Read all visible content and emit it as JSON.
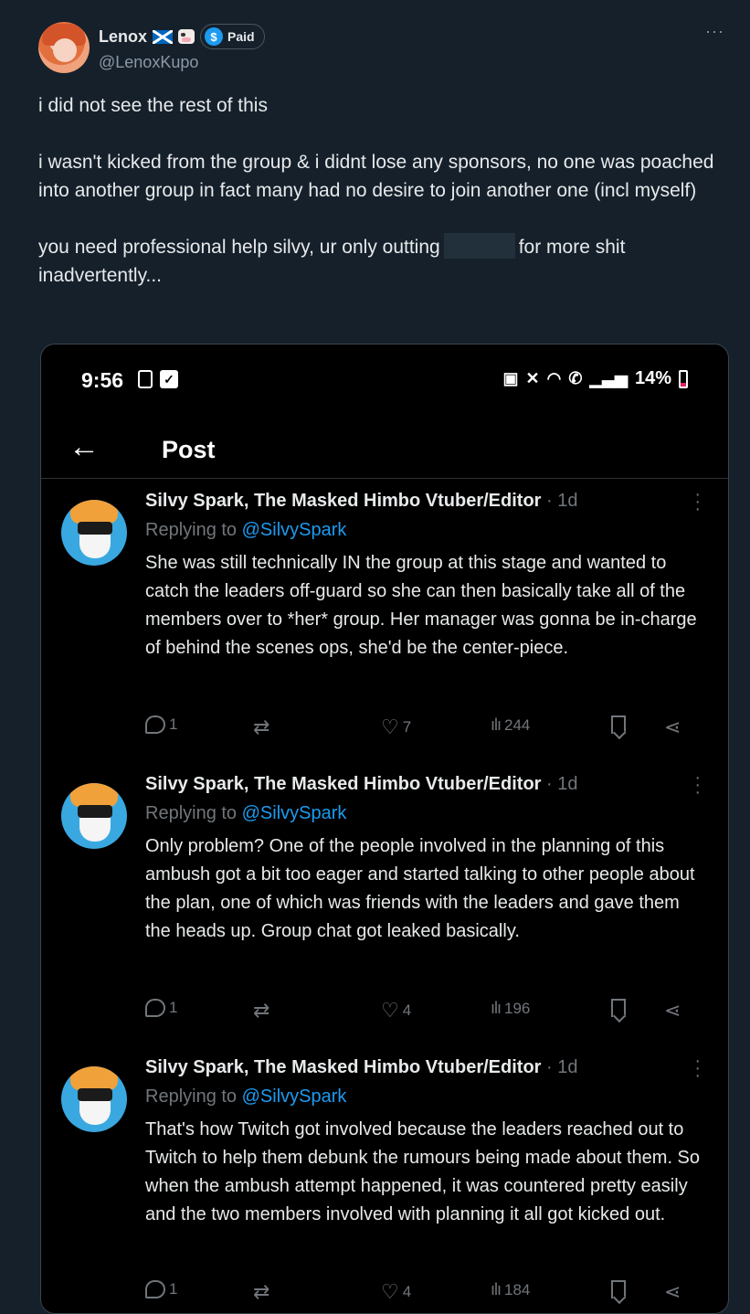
{
  "outer": {
    "display_name": "Lenox",
    "paid_badge": "Paid",
    "dollar_symbol": "$",
    "handle": "@LenoxKupo",
    "more_symbol": "···",
    "paragraphs": [
      "i did not see the rest of this",
      "i wasn't kicked from the group & i didnt lose any sponsors, no one was poached into another group in fact many had no desire to join another one (incl myself)"
    ],
    "para3_start": "you need professional help silvy, ur only outting",
    "para3_end": "for more shit inadvertently..."
  },
  "phone": {
    "time": "9:56",
    "battery_pct": "14%",
    "back_symbol": "←",
    "header_title": "Post"
  },
  "replies": [
    {
      "author": "Silvy Spark, The Masked Himbo Vtuber/Editor",
      "time": "· 1d",
      "replying_prefix": "Replying to ",
      "mention": "@SilvySpark",
      "body": "She was still technically IN the group at this stage and wanted to catch the leaders off-guard so she can then basically take all of the members over to *her* group. Her manager was gonna be in-charge of behind the scenes ops, she'd be the center-piece.",
      "replies": "1",
      "likes": "7",
      "views": "244"
    },
    {
      "author": "Silvy Spark, The Masked Himbo Vtuber/Editor",
      "time": "· 1d",
      "replying_prefix": "Replying to ",
      "mention": "@SilvySpark",
      "body": "Only problem? One of the people involved in the planning of this ambush got a bit too eager and started talking to other people about the plan, one of which was friends with the leaders and gave them the heads up. Group chat got leaked basically.",
      "replies": "1",
      "likes": "4",
      "views": "196"
    },
    {
      "author": "Silvy Spark, The Masked Himbo Vtuber/Editor",
      "time": "· 1d",
      "replying_prefix": "Replying to ",
      "mention": "@SilvySpark",
      "body": "That's how Twitch got involved because the leaders reached out to Twitch to help them debunk the rumours being made about them. So when the ambush attempt happened, it was countered pretty easily and the two members involved with planning it all got kicked out.",
      "replies": "1",
      "likes": "4",
      "views": "184"
    }
  ],
  "colors": {
    "background": "#15202b",
    "embed_bg": "#000000",
    "accent": "#1d9bf0",
    "muted": "#71767b"
  }
}
